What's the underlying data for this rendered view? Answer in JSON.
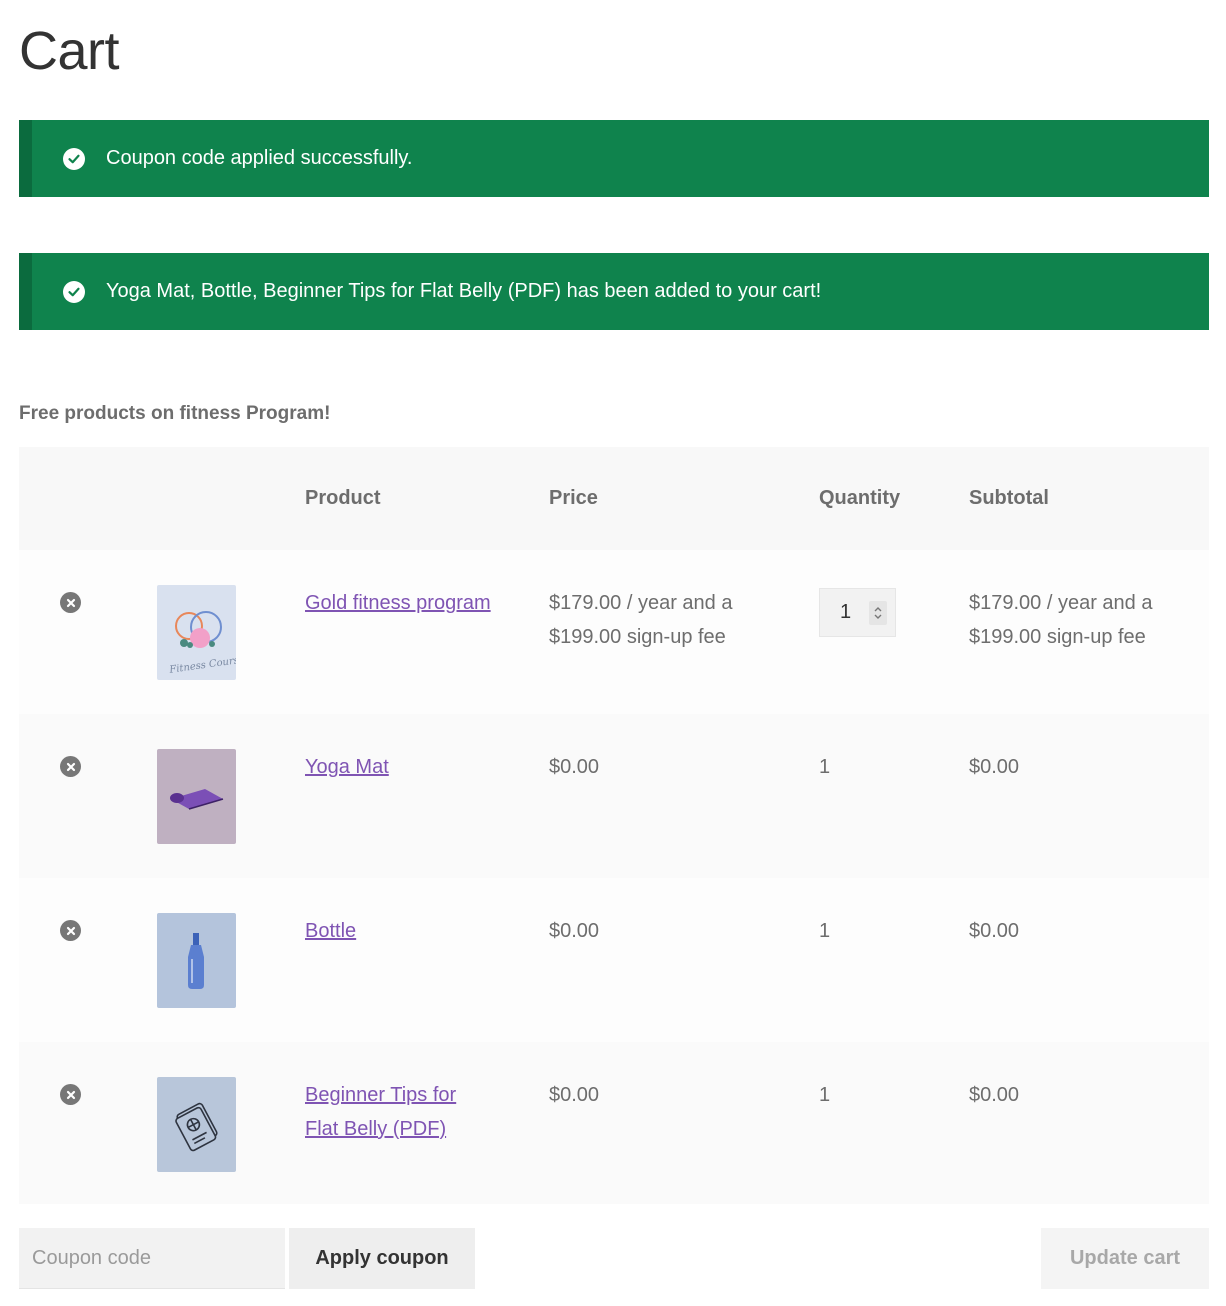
{
  "page": {
    "title": "Cart"
  },
  "notices": [
    {
      "icon": "check-circle-icon",
      "message": "Coupon code applied successfully."
    },
    {
      "icon": "check-circle-icon",
      "message": "Yoga Mat, Bottle, Beginner Tips for Flat Belly (PDF) has been added to your cart!"
    }
  ],
  "promo_text": "Free products on fitness Program!",
  "table": {
    "headers": {
      "product": "Product",
      "price": "Price",
      "quantity": "Quantity",
      "subtotal": "Subtotal"
    },
    "rows": [
      {
        "product": "Gold fitness program",
        "price": "$179.00 / year and a $199.00 sign-up fee",
        "quantity": "1",
        "subtotal": "$179.00 / year and a $199.00 sign-up fee",
        "quantity_editable": true,
        "thumb_bg": "#d9e1ef"
      },
      {
        "product": "Yoga Mat",
        "price": "$0.00",
        "quantity": "1",
        "subtotal": "$0.00",
        "thumb_bg": "#bfb0c1"
      },
      {
        "product": "Bottle",
        "price": "$0.00",
        "quantity": "1",
        "subtotal": "$0.00",
        "thumb_bg": "#b4c4dc"
      },
      {
        "product": "Beginner Tips for Flat Belly (PDF)",
        "price": "$0.00",
        "quantity": "1",
        "subtotal": "$0.00",
        "thumb_bg": "#b8c6da"
      }
    ]
  },
  "actions": {
    "coupon_placeholder": "Coupon code",
    "apply_label": "Apply coupon",
    "update_label": "Update cart"
  },
  "colors": {
    "notice_bg": "#0f834d",
    "link": "#7f54b3",
    "text": "#6d6d6d"
  }
}
